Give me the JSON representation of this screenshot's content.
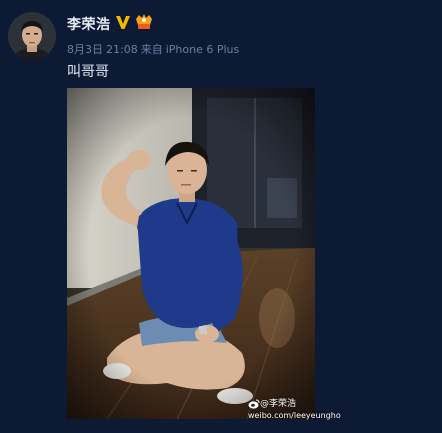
{
  "user": {
    "name": "李荣浩",
    "verified_icon": "verified-v-icon",
    "vip_icon": "vip-crown-icon"
  },
  "meta": {
    "date": "8月3日",
    "time": "21:08",
    "source_prefix": "来自",
    "source_device": "iPhone 6 Plus"
  },
  "post": {
    "text": "叫哥哥"
  },
  "photo": {
    "watermark_handle": "@李荣浩",
    "watermark_url": "weibo.com/leeyeungho"
  },
  "colors": {
    "background": "#0c1a33",
    "text_primary": "#e4e9f2",
    "text_secondary": "#6b7ea3",
    "verified_gold": "#f5b800"
  }
}
